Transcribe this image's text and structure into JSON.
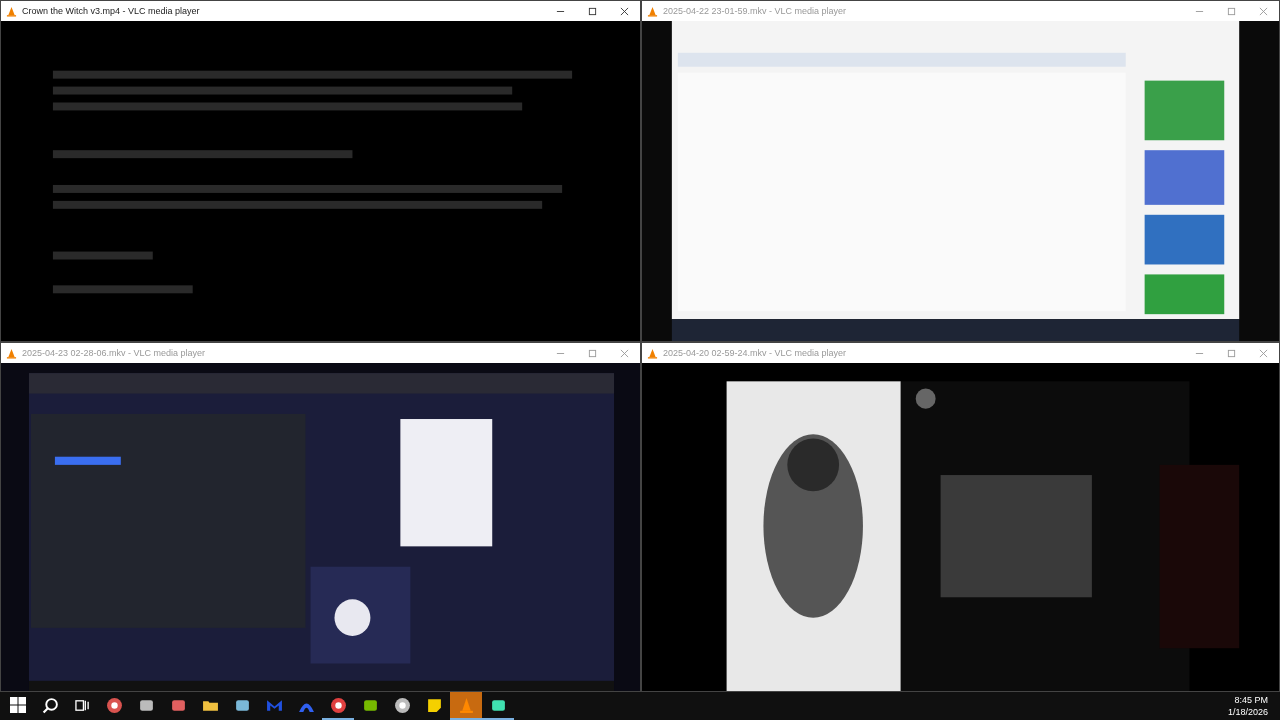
{
  "windows": [
    {
      "title": "Crown the Witch v3.mp4 - VLC media player",
      "active": true
    },
    {
      "title": "2025-04-22 23-01-59.mkv - VLC media player",
      "active": false
    },
    {
      "title": "2025-04-23 02-28-06.mkv - VLC media player",
      "active": false
    },
    {
      "title": "2025-04-20 02-59-24.mkv - VLC media player",
      "active": false
    }
  ],
  "taskbar": {
    "apps": [
      {
        "kind": "compass",
        "running": false,
        "active": false
      },
      {
        "kind": "drive",
        "running": false,
        "active": false
      },
      {
        "kind": "window",
        "running": false,
        "active": false
      },
      {
        "kind": "folder",
        "running": false,
        "active": false
      },
      {
        "kind": "notepad",
        "running": false,
        "active": false
      },
      {
        "kind": "m",
        "running": false,
        "active": false
      },
      {
        "kind": "arch",
        "running": false,
        "active": false
      },
      {
        "kind": "globe",
        "running": true,
        "active": false
      },
      {
        "kind": "eye",
        "running": false,
        "active": false
      },
      {
        "kind": "aperture",
        "running": false,
        "active": false
      },
      {
        "kind": "note",
        "running": false,
        "active": false
      },
      {
        "kind": "cone",
        "running": true,
        "active": true
      },
      {
        "kind": "screen",
        "running": true,
        "active": false
      }
    ],
    "time": "8:45 PM",
    "date": "1/18/2026"
  }
}
